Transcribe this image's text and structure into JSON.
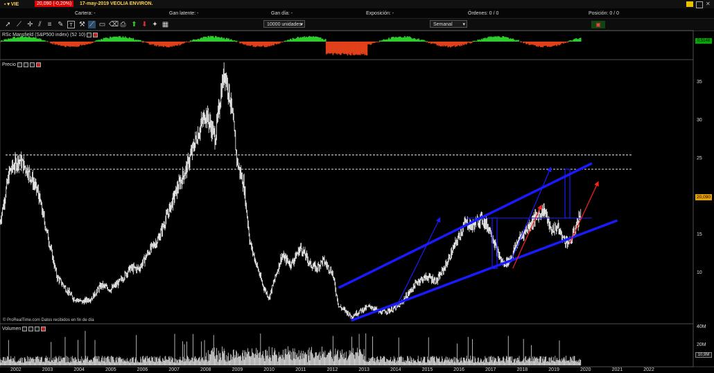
{
  "header": {
    "ticker": "VIE",
    "quote": "20,090 (-0,20%)",
    "title": "17-may-2019 VEOLIA ENVIRON."
  },
  "info": {
    "cartera": "Cartera: -",
    "gan_latente": "Gan latente: -",
    "gan_dia": "Gan día: -",
    "exposicion": "Exposición: -",
    "ordenes": "Órdenes: 0 / 0",
    "posicion": "Posición: 0 / 0"
  },
  "toolbar": {
    "quantity": "10000 unidades",
    "period": "Semanal",
    "icons": [
      "cursor-icon",
      "line-icon",
      "crosshair-icon",
      "pencil-icon",
      "text-icon",
      "magnet-icon",
      "trendline-icon",
      "shape-icon",
      "delete-icon",
      "print-icon",
      "up-arrow-icon",
      "down-arrow-icon",
      "star-icon",
      "flag-icon",
      "circle-icon",
      "contract-icon",
      "calendar-icon"
    ]
  },
  "panels": {
    "rsc_label": "RSc Mansfield (S&P500 index) (52 10)",
    "rsc_value": "0,5148",
    "price_label": "Precio",
    "price_value": "20,090",
    "volume_label": "Volumen",
    "volume_value": "10,9M",
    "source_note": "© ProRealTime.com Datos recibidos en fin de día"
  },
  "colors": {
    "candles": "#ffffff",
    "channel": "#1a1aff",
    "arrow_blue": "#1a1aff",
    "arrow_red": "#ff2020",
    "rsc_up": "#2ecc2e",
    "rsc_down": "#e0401a",
    "price_box": "#e8a000"
  },
  "chart_data": {
    "type": "line",
    "title": "VEOLIA ENVIRON. semanal",
    "ylim": [
      7,
      38
    ],
    "yticks": [
      "35",
      "30",
      "25",
      "20",
      "15",
      "10"
    ],
    "x": [
      "2002",
      "2003",
      "2004",
      "2005",
      "2006",
      "2007",
      "2008",
      "2009",
      "2010",
      "2011",
      "2012",
      "2013",
      "2014",
      "2015",
      "2016",
      "2017",
      "2018",
      "2019",
      "2020",
      "2021",
      "2022"
    ],
    "series": [
      {
        "name": "Precio",
        "points": [
          [
            2001.0,
            19.0
          ],
          [
            2001.3,
            25.0
          ],
          [
            2001.6,
            26.5
          ],
          [
            2001.9,
            25.0
          ],
          [
            2002.2,
            22.5
          ],
          [
            2002.5,
            17.5
          ],
          [
            2002.8,
            12.5
          ],
          [
            2003.1,
            11.0
          ],
          [
            2003.3,
            10.0
          ],
          [
            2003.6,
            9.5
          ],
          [
            2003.9,
            10.0
          ],
          [
            2004.2,
            11.5
          ],
          [
            2004.5,
            11.0
          ],
          [
            2004.8,
            12.0
          ],
          [
            2005.1,
            13.5
          ],
          [
            2005.4,
            13.5
          ],
          [
            2005.7,
            15.5
          ],
          [
            2006.0,
            17.0
          ],
          [
            2006.3,
            20.0
          ],
          [
            2006.6,
            23.0
          ],
          [
            2006.9,
            25.5
          ],
          [
            2007.2,
            29.0
          ],
          [
            2007.5,
            32.0
          ],
          [
            2007.8,
            29.0
          ],
          [
            2008.0,
            35.0
          ],
          [
            2008.1,
            37.0
          ],
          [
            2008.3,
            33.0
          ],
          [
            2008.5,
            26.0
          ],
          [
            2008.7,
            23.5
          ],
          [
            2008.9,
            16.5
          ],
          [
            2009.1,
            14.0
          ],
          [
            2009.3,
            11.5
          ],
          [
            2009.5,
            10.0
          ],
          [
            2009.7,
            12.5
          ],
          [
            2009.9,
            15.0
          ],
          [
            2010.2,
            14.0
          ],
          [
            2010.5,
            16.0
          ],
          [
            2010.8,
            14.0
          ],
          [
            2011.0,
            13.5
          ],
          [
            2011.2,
            14.5
          ],
          [
            2011.5,
            13.0
          ],
          [
            2011.7,
            9.0
          ],
          [
            2011.9,
            8.5
          ],
          [
            2012.1,
            7.8
          ],
          [
            2012.4,
            8.5
          ],
          [
            2012.7,
            9.0
          ],
          [
            2013.0,
            8.3
          ],
          [
            2013.3,
            8.5
          ],
          [
            2013.6,
            9.0
          ],
          [
            2013.9,
            10.5
          ],
          [
            2014.2,
            12.0
          ],
          [
            2014.5,
            12.5
          ],
          [
            2014.8,
            12.0
          ],
          [
            2015.1,
            14.0
          ],
          [
            2015.4,
            16.5
          ],
          [
            2015.7,
            19.0
          ],
          [
            2015.9,
            18.5
          ],
          [
            2016.2,
            19.5
          ],
          [
            2016.5,
            18.0
          ],
          [
            2016.7,
            15.5
          ],
          [
            2016.9,
            14.0
          ],
          [
            2017.1,
            14.5
          ],
          [
            2017.4,
            17.0
          ],
          [
            2017.7,
            18.5
          ],
          [
            2017.9,
            19.5
          ],
          [
            2018.2,
            20.5
          ],
          [
            2018.4,
            18.0
          ],
          [
            2018.6,
            18.5
          ],
          [
            2018.8,
            17.0
          ],
          [
            2019.0,
            16.5
          ],
          [
            2019.2,
            18.5
          ],
          [
            2019.35,
            20.09
          ]
        ]
      },
      {
        "name": "Volumen",
        "unit": "M",
        "ylim": [
          0,
          45
        ],
        "yticks": [
          "40M",
          "20M"
        ]
      },
      {
        "name": "RSc Mansfield",
        "ylim": [
          -1,
          1
        ]
      }
    ],
    "annotations": {
      "resistance_levels": [
        27.0,
        25.3
      ],
      "support_level": 19.5,
      "channel_upper": [
        [
          2011.7,
          11.2
        ],
        [
          2019.7,
          26.0
        ]
      ],
      "channel_lower": [
        [
          2012.1,
          7.3
        ],
        [
          2020.5,
          19.2
        ]
      ]
    }
  }
}
